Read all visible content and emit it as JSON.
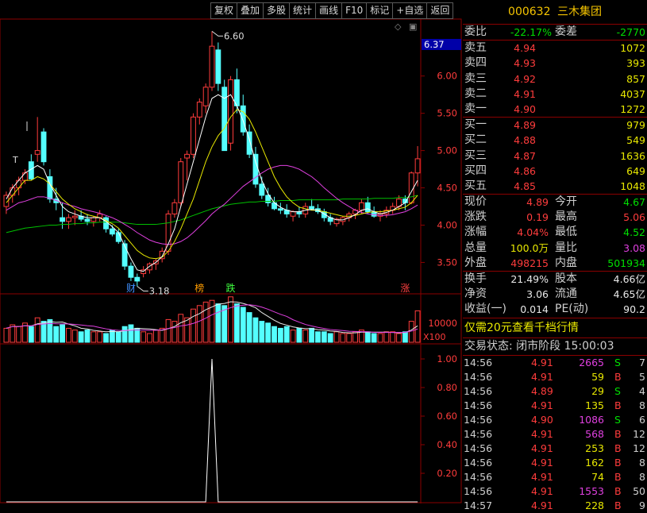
{
  "toolbar": {
    "buttons": [
      "复权",
      "叠加",
      "多股",
      "统计",
      "画线",
      "F10",
      "标记",
      "+自选",
      "返回"
    ]
  },
  "chart": {
    "current_price_tag": "6.37",
    "high_label": "6.60",
    "low_label": "3.18",
    "t_marker": "T",
    "price_axis": [
      "6.00",
      "5.50",
      "5.00",
      "4.50",
      "4.00",
      "3.50"
    ],
    "volume_axis": [
      "10000",
      "X100"
    ],
    "indicator_axis": [
      "1.00",
      "0.80",
      "0.60",
      "0.40",
      "0.20"
    ],
    "event_tags": [
      {
        "text": "财",
        "color": "#4090ff"
      },
      {
        "text": "榜",
        "color": "#ff9c00"
      },
      {
        "text": "跌",
        "color": "#40ff40"
      },
      {
        "text": "涨",
        "color": "#ff4040"
      }
    ]
  },
  "chart_data": {
    "type": "candlestick",
    "ylim": [
      3.1,
      6.7
    ],
    "candles": [
      [
        4.25,
        4.45,
        4.15,
        4.4
      ],
      [
        4.4,
        4.55,
        4.3,
        4.5
      ],
      [
        4.5,
        4.65,
        4.4,
        4.6
      ],
      [
        4.6,
        4.75,
        4.55,
        4.7
      ],
      [
        4.85,
        4.95,
        4.6,
        4.62
      ],
      [
        4.95,
        5.45,
        4.85,
        5.0
      ],
      [
        5.25,
        5.3,
        4.8,
        4.85
      ],
      [
        4.65,
        4.75,
        4.3,
        4.35
      ],
      [
        4.35,
        4.5,
        4.2,
        4.3
      ],
      [
        4.1,
        4.3,
        3.95,
        4.05
      ],
      [
        4.05,
        4.15,
        3.95,
        4.1
      ],
      [
        4.1,
        4.2,
        4.0,
        4.12
      ],
      [
        4.12,
        4.2,
        4.05,
        4.08
      ],
      [
        4.08,
        4.15,
        4.0,
        4.05
      ],
      [
        4.05,
        4.12,
        3.98,
        4.1
      ],
      [
        4.1,
        4.2,
        4.05,
        4.15
      ],
      [
        4.1,
        4.12,
        3.9,
        3.95
      ],
      [
        3.95,
        4.0,
        3.85,
        3.88
      ],
      [
        3.9,
        3.95,
        3.75,
        3.78
      ],
      [
        3.75,
        3.8,
        3.4,
        3.45
      ],
      [
        3.45,
        3.5,
        3.25,
        3.3
      ],
      [
        3.3,
        3.35,
        3.18,
        3.25
      ],
      [
        3.35,
        3.45,
        3.3,
        3.4
      ],
      [
        3.4,
        3.5,
        3.35,
        3.48
      ],
      [
        3.48,
        3.55,
        3.4,
        3.52
      ],
      [
        3.55,
        3.7,
        3.5,
        3.65
      ],
      [
        3.65,
        4.2,
        3.6,
        4.15
      ],
      [
        4.15,
        4.35,
        4.1,
        4.3
      ],
      [
        4.3,
        4.9,
        4.25,
        4.85
      ],
      [
        4.9,
        5.0,
        4.6,
        4.95
      ],
      [
        4.95,
        5.5,
        4.9,
        5.45
      ],
      [
        5.45,
        5.7,
        5.35,
        5.65
      ],
      [
        5.6,
        5.9,
        5.5,
        5.85
      ],
      [
        5.85,
        6.6,
        5.8,
        6.4
      ],
      [
        6.35,
        6.45,
        5.8,
        5.9
      ],
      [
        5.85,
        5.95,
        5.1,
        5.0
      ],
      [
        5.1,
        6.0,
        5.0,
        5.95
      ],
      [
        5.95,
        6.1,
        5.5,
        5.6
      ],
      [
        5.6,
        5.75,
        5.2,
        5.25
      ],
      [
        5.25,
        5.35,
        4.9,
        4.95
      ],
      [
        4.95,
        5.05,
        4.5,
        4.55
      ],
      [
        4.55,
        4.65,
        4.35,
        4.4
      ],
      [
        4.4,
        4.5,
        4.25,
        4.3
      ],
      [
        4.3,
        4.38,
        4.2,
        4.22
      ],
      [
        4.22,
        4.3,
        4.15,
        4.2
      ],
      [
        4.2,
        4.28,
        4.1,
        4.15
      ],
      [
        4.12,
        4.2,
        4.05,
        4.18
      ],
      [
        4.18,
        4.25,
        4.1,
        4.15
      ],
      [
        4.15,
        4.3,
        4.1,
        4.25
      ],
      [
        4.25,
        4.35,
        4.2,
        4.22
      ],
      [
        4.22,
        4.28,
        4.15,
        4.18
      ],
      [
        4.18,
        4.22,
        4.05,
        4.1
      ],
      [
        4.1,
        4.15,
        4.0,
        4.05
      ],
      [
        4.02,
        4.1,
        3.98,
        4.08
      ],
      [
        4.05,
        4.12,
        4.0,
        4.1
      ],
      [
        4.1,
        4.18,
        4.05,
        4.15
      ],
      [
        4.15,
        4.22,
        4.08,
        4.2
      ],
      [
        4.2,
        4.35,
        4.15,
        4.3
      ],
      [
        4.3,
        4.38,
        4.15,
        4.18
      ],
      [
        4.18,
        4.25,
        4.1,
        4.12
      ],
      [
        4.12,
        4.2,
        4.05,
        4.15
      ],
      [
        4.15,
        4.25,
        4.1,
        4.2
      ],
      [
        4.2,
        4.3,
        4.15,
        4.25
      ],
      [
        4.25,
        4.4,
        4.2,
        4.35
      ],
      [
        4.35,
        4.4,
        4.2,
        4.3
      ],
      [
        4.3,
        4.72,
        4.28,
        4.7
      ],
      [
        4.7,
        5.06,
        4.52,
        4.89
      ]
    ],
    "ma_yellow": [
      4.3,
      4.4,
      4.5,
      4.6,
      4.6,
      4.65,
      4.62,
      4.55,
      4.45,
      4.35,
      4.28,
      4.22,
      4.18,
      4.14,
      4.12,
      4.1,
      4.06,
      4.02,
      3.96,
      3.86,
      3.76,
      3.66,
      3.6,
      3.56,
      3.55,
      3.57,
      3.65,
      3.78,
      3.95,
      4.15,
      4.35,
      4.6,
      4.85,
      5.05,
      5.2,
      5.3,
      5.45,
      5.55,
      5.52,
      5.42,
      5.25,
      5.05,
      4.85,
      4.65,
      4.5,
      4.38,
      4.3,
      4.24,
      4.22,
      4.2,
      4.2,
      4.18,
      4.16,
      4.14,
      4.12,
      4.12,
      4.13,
      4.15,
      4.17,
      4.18,
      4.18,
      4.19,
      4.2,
      4.22,
      4.24,
      4.3,
      4.4
    ],
    "ma_white": [
      4.35,
      4.5,
      4.6,
      4.7,
      4.75,
      4.8,
      4.75,
      4.55,
      4.4,
      4.25,
      4.18,
      4.15,
      4.12,
      4.1,
      4.1,
      4.1,
      4.05,
      3.98,
      3.9,
      3.72,
      3.55,
      3.4,
      3.38,
      3.45,
      3.5,
      3.58,
      3.75,
      3.95,
      4.25,
      4.55,
      4.85,
      5.15,
      5.45,
      5.7,
      5.75,
      5.7,
      5.75,
      5.6,
      5.4,
      5.15,
      4.85,
      4.6,
      4.42,
      4.3,
      4.24,
      4.2,
      4.18,
      4.18,
      4.2,
      4.21,
      4.2,
      4.15,
      4.1,
      4.07,
      4.07,
      4.1,
      4.14,
      4.2,
      4.22,
      4.18,
      4.15,
      4.17,
      4.2,
      4.25,
      4.3,
      4.45,
      4.6
    ],
    "ma_magenta": [
      4.2,
      4.25,
      4.3,
      4.32,
      4.35,
      4.38,
      4.38,
      4.36,
      4.33,
      4.3,
      4.27,
      4.25,
      4.22,
      4.2,
      4.18,
      4.16,
      4.13,
      4.1,
      4.06,
      4.01,
      3.96,
      3.9,
      3.85,
      3.8,
      3.77,
      3.75,
      3.74,
      3.75,
      3.78,
      3.83,
      3.9,
      3.98,
      4.06,
      4.15,
      4.22,
      4.28,
      4.36,
      4.44,
      4.52,
      4.58,
      4.64,
      4.7,
      4.75,
      4.78,
      4.8,
      4.8,
      4.78,
      4.75,
      4.7,
      4.65,
      4.58,
      4.5,
      4.43,
      4.36,
      4.3,
      4.25,
      4.2,
      4.17,
      4.15,
      4.14,
      4.13,
      4.13,
      4.14,
      4.16,
      4.18,
      4.22,
      4.27
    ],
    "ma_green": [
      3.9,
      3.92,
      3.94,
      3.96,
      3.97,
      3.98,
      3.99,
      4.0,
      4.0,
      4.01,
      4.01,
      4.02,
      4.02,
      4.03,
      4.03,
      4.04,
      4.04,
      4.04,
      4.04,
      4.03,
      4.02,
      4.01,
      4.01,
      4.01,
      4.01,
      4.02,
      4.03,
      4.05,
      4.07,
      4.1,
      4.13,
      4.16,
      4.19,
      4.22,
      4.24,
      4.26,
      4.28,
      4.29,
      4.3,
      4.31,
      4.31,
      4.32,
      4.32,
      4.32,
      4.33,
      4.33,
      4.33,
      4.34,
      4.34,
      4.34,
      4.34,
      4.34,
      4.34,
      4.34,
      4.35,
      4.35,
      4.35,
      4.35,
      4.35,
      4.36,
      4.36,
      4.36,
      4.36,
      4.37,
      4.37,
      4.38,
      4.4
    ],
    "volumes": [
      8,
      10,
      9,
      11,
      9,
      14,
      12,
      13,
      9,
      10,
      8,
      7,
      6,
      7,
      6,
      6,
      5,
      7,
      6,
      9,
      10,
      8,
      6,
      5,
      7,
      8,
      13,
      12,
      16,
      14,
      19,
      21,
      23,
      24,
      22,
      21,
      26,
      22,
      20,
      17,
      14,
      12,
      11,
      9,
      8,
      9,
      7,
      8,
      7,
      8,
      6,
      6,
      5,
      6,
      5,
      5,
      6,
      7,
      6,
      5,
      5,
      6,
      6,
      5,
      6,
      12,
      18
    ],
    "vol_max": 25,
    "indicator": {
      "spike_index": 33,
      "spike_value": 1.0
    }
  },
  "quote": {
    "code": "000632",
    "name": "三木集团",
    "weibi_label": "委比",
    "weibi": "-22.17%",
    "weicha_label": "委差",
    "weicha": "-2770",
    "asks": [
      {
        "label": "卖五",
        "price": "4.94",
        "vol": "1072"
      },
      {
        "label": "卖四",
        "price": "4.93",
        "vol": "393"
      },
      {
        "label": "卖三",
        "price": "4.92",
        "vol": "857"
      },
      {
        "label": "卖二",
        "price": "4.91",
        "vol": "4037"
      },
      {
        "label": "卖一",
        "price": "4.90",
        "vol": "1272"
      }
    ],
    "bids": [
      {
        "label": "买一",
        "price": "4.89",
        "vol": "979"
      },
      {
        "label": "买二",
        "price": "4.88",
        "vol": "549"
      },
      {
        "label": "买三",
        "price": "4.87",
        "vol": "1636"
      },
      {
        "label": "买四",
        "price": "4.86",
        "vol": "649"
      },
      {
        "label": "买五",
        "price": "4.85",
        "vol": "1048"
      }
    ],
    "stats": [
      {
        "l1": "现价",
        "v1": "4.89",
        "c1": "red",
        "l2": "今开",
        "v2": "4.67",
        "c2": "green"
      },
      {
        "l1": "涨跌",
        "v1": "0.19",
        "c1": "red",
        "l2": "最高",
        "v2": "5.06",
        "c2": "red"
      },
      {
        "l1": "涨幅",
        "v1": "4.04%",
        "c1": "red",
        "l2": "最低",
        "v2": "4.52",
        "c2": "green"
      },
      {
        "l1": "总量",
        "v1": "100.0万",
        "c1": "yellow",
        "l2": "量比",
        "v2": "3.08",
        "c2": "magenta"
      },
      {
        "l1": "外盘",
        "v1": "498215",
        "c1": "red",
        "l2": "内盘",
        "v2": "501934",
        "c2": "green"
      }
    ],
    "stats2": [
      {
        "l1": "换手",
        "v1": "21.49%",
        "l2": "股本",
        "v2": "4.66亿"
      },
      {
        "l1": "净资",
        "v1": "3.06",
        "l2": "流通",
        "v2": "4.65亿"
      },
      {
        "l1": "收益(一)",
        "v1": "0.014",
        "l2": "PE(动)",
        "v2": "90.2"
      }
    ],
    "promo": "仅需20元查看千档行情",
    "trade_state": "交易状态: 闭市阶段 15:00:03",
    "ticks": [
      {
        "time": "14:56",
        "price": "4.91",
        "vol": "2665",
        "vc": "magenta",
        "bs": "S",
        "bsc": "green",
        "cnt": "7"
      },
      {
        "time": "14:56",
        "price": "4.91",
        "vol": "59",
        "vc": "yellow",
        "bs": "B",
        "bsc": "red",
        "cnt": "5"
      },
      {
        "time": "14:56",
        "price": "4.89",
        "vol": "29",
        "vc": "yellow",
        "bs": "S",
        "bsc": "green",
        "cnt": "4"
      },
      {
        "time": "14:56",
        "price": "4.91",
        "vol": "135",
        "vc": "yellow",
        "bs": "B",
        "bsc": "red",
        "cnt": "8"
      },
      {
        "time": "14:56",
        "price": "4.90",
        "vol": "1086",
        "vc": "magenta",
        "bs": "S",
        "bsc": "green",
        "cnt": "6"
      },
      {
        "time": "14:56",
        "price": "4.91",
        "vol": "568",
        "vc": "magenta",
        "bs": "B",
        "bsc": "red",
        "cnt": "12"
      },
      {
        "time": "14:56",
        "price": "4.91",
        "vol": "253",
        "vc": "yellow",
        "bs": "B",
        "bsc": "red",
        "cnt": "12"
      },
      {
        "time": "14:56",
        "price": "4.91",
        "vol": "162",
        "vc": "yellow",
        "bs": "B",
        "bsc": "red",
        "cnt": "8"
      },
      {
        "time": "14:56",
        "price": "4.91",
        "vol": "74",
        "vc": "yellow",
        "bs": "B",
        "bsc": "red",
        "cnt": "8"
      },
      {
        "time": "14:56",
        "price": "4.91",
        "vol": "1553",
        "vc": "magenta",
        "bs": "B",
        "bsc": "red",
        "cnt": "50"
      },
      {
        "time": "14:57",
        "price": "4.91",
        "vol": "228",
        "vc": "yellow",
        "bs": "B",
        "bsc": "red",
        "cnt": "9"
      }
    ]
  },
  "colors": {
    "up": "#ff3c3c",
    "down": "#54ffff",
    "grid": "#8b0000",
    "ma_white": "#ffffff",
    "ma_yellow": "#e8e800",
    "ma_magenta": "#e040e0",
    "ma_green": "#00c000"
  }
}
